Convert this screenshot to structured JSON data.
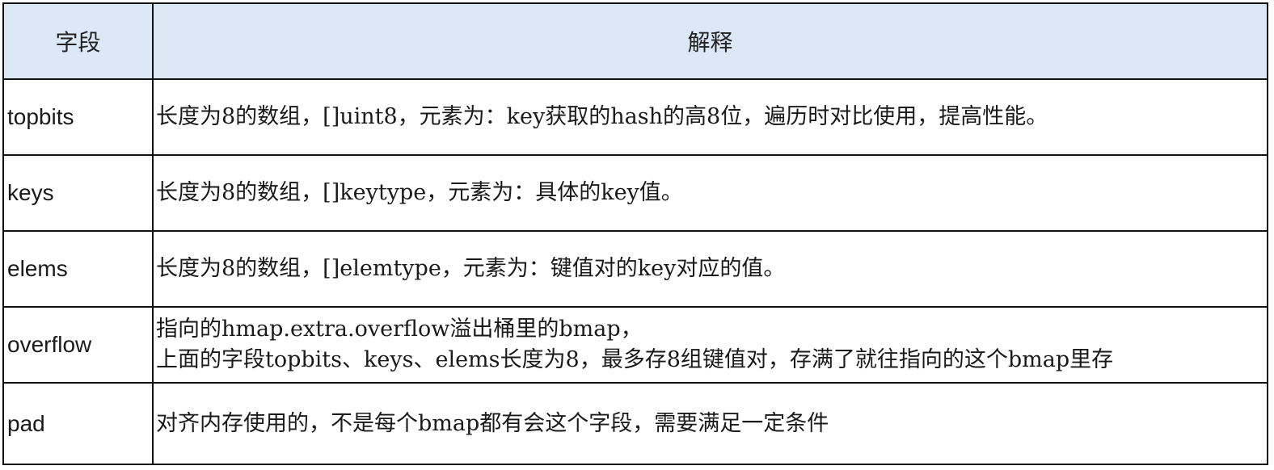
{
  "table": {
    "headers": {
      "field": "字段",
      "description": "解释"
    },
    "rows": [
      {
        "field": "topbits",
        "lines": [
          "长度为8的数组，[]uint8，元素为：key获取的hash的高8位，遍历时对比使用，提高性能。"
        ]
      },
      {
        "field": "keys",
        "lines": [
          "长度为8的数组，[]keytype，元素为：具体的key值。"
        ]
      },
      {
        "field": "elems",
        "lines": [
          "长度为8的数组，[]elemtype，元素为：键值对的key对应的值。"
        ]
      },
      {
        "field": "overflow",
        "lines": [
          "指向的hmap.extra.overflow溢出桶里的bmap，",
          "上面的字段topbits、keys、elems长度为8，最多存8组键值对，存满了就往指向的这个bmap里存"
        ]
      },
      {
        "field": "pad",
        "lines": [
          "对齐内存使用的，不是每个bmap都有会这个字段，需要满足一定条件"
        ]
      }
    ]
  }
}
